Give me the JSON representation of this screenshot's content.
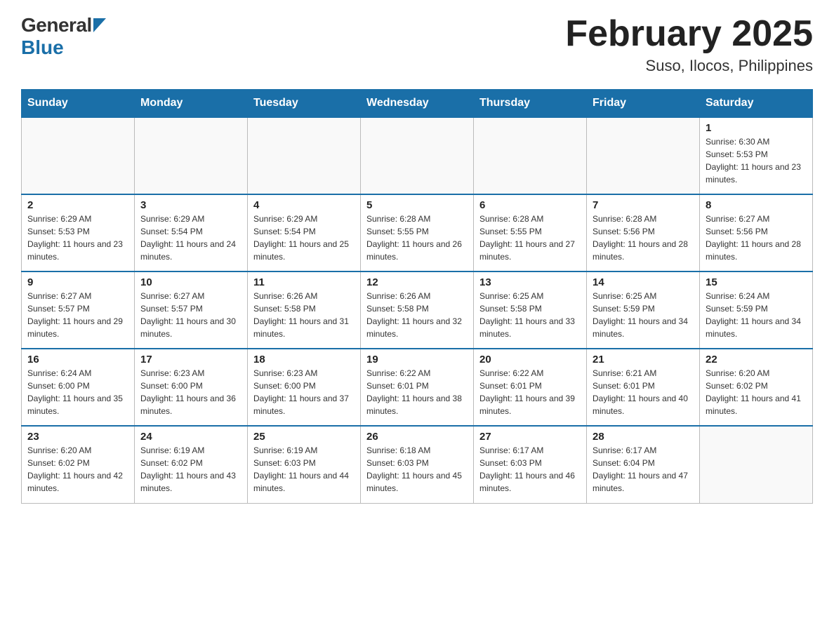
{
  "header": {
    "logo_general": "General",
    "logo_blue": "Blue",
    "month_title": "February 2025",
    "location": "Suso, Ilocos, Philippines"
  },
  "calendar": {
    "days_of_week": [
      "Sunday",
      "Monday",
      "Tuesday",
      "Wednesday",
      "Thursday",
      "Friday",
      "Saturday"
    ],
    "weeks": [
      [
        {
          "day": "",
          "info": ""
        },
        {
          "day": "",
          "info": ""
        },
        {
          "day": "",
          "info": ""
        },
        {
          "day": "",
          "info": ""
        },
        {
          "day": "",
          "info": ""
        },
        {
          "day": "",
          "info": ""
        },
        {
          "day": "1",
          "info": "Sunrise: 6:30 AM\nSunset: 5:53 PM\nDaylight: 11 hours and 23 minutes."
        }
      ],
      [
        {
          "day": "2",
          "info": "Sunrise: 6:29 AM\nSunset: 5:53 PM\nDaylight: 11 hours and 23 minutes."
        },
        {
          "day": "3",
          "info": "Sunrise: 6:29 AM\nSunset: 5:54 PM\nDaylight: 11 hours and 24 minutes."
        },
        {
          "day": "4",
          "info": "Sunrise: 6:29 AM\nSunset: 5:54 PM\nDaylight: 11 hours and 25 minutes."
        },
        {
          "day": "5",
          "info": "Sunrise: 6:28 AM\nSunset: 5:55 PM\nDaylight: 11 hours and 26 minutes."
        },
        {
          "day": "6",
          "info": "Sunrise: 6:28 AM\nSunset: 5:55 PM\nDaylight: 11 hours and 27 minutes."
        },
        {
          "day": "7",
          "info": "Sunrise: 6:28 AM\nSunset: 5:56 PM\nDaylight: 11 hours and 28 minutes."
        },
        {
          "day": "8",
          "info": "Sunrise: 6:27 AM\nSunset: 5:56 PM\nDaylight: 11 hours and 28 minutes."
        }
      ],
      [
        {
          "day": "9",
          "info": "Sunrise: 6:27 AM\nSunset: 5:57 PM\nDaylight: 11 hours and 29 minutes."
        },
        {
          "day": "10",
          "info": "Sunrise: 6:27 AM\nSunset: 5:57 PM\nDaylight: 11 hours and 30 minutes."
        },
        {
          "day": "11",
          "info": "Sunrise: 6:26 AM\nSunset: 5:58 PM\nDaylight: 11 hours and 31 minutes."
        },
        {
          "day": "12",
          "info": "Sunrise: 6:26 AM\nSunset: 5:58 PM\nDaylight: 11 hours and 32 minutes."
        },
        {
          "day": "13",
          "info": "Sunrise: 6:25 AM\nSunset: 5:58 PM\nDaylight: 11 hours and 33 minutes."
        },
        {
          "day": "14",
          "info": "Sunrise: 6:25 AM\nSunset: 5:59 PM\nDaylight: 11 hours and 34 minutes."
        },
        {
          "day": "15",
          "info": "Sunrise: 6:24 AM\nSunset: 5:59 PM\nDaylight: 11 hours and 34 minutes."
        }
      ],
      [
        {
          "day": "16",
          "info": "Sunrise: 6:24 AM\nSunset: 6:00 PM\nDaylight: 11 hours and 35 minutes."
        },
        {
          "day": "17",
          "info": "Sunrise: 6:23 AM\nSunset: 6:00 PM\nDaylight: 11 hours and 36 minutes."
        },
        {
          "day": "18",
          "info": "Sunrise: 6:23 AM\nSunset: 6:00 PM\nDaylight: 11 hours and 37 minutes."
        },
        {
          "day": "19",
          "info": "Sunrise: 6:22 AM\nSunset: 6:01 PM\nDaylight: 11 hours and 38 minutes."
        },
        {
          "day": "20",
          "info": "Sunrise: 6:22 AM\nSunset: 6:01 PM\nDaylight: 11 hours and 39 minutes."
        },
        {
          "day": "21",
          "info": "Sunrise: 6:21 AM\nSunset: 6:01 PM\nDaylight: 11 hours and 40 minutes."
        },
        {
          "day": "22",
          "info": "Sunrise: 6:20 AM\nSunset: 6:02 PM\nDaylight: 11 hours and 41 minutes."
        }
      ],
      [
        {
          "day": "23",
          "info": "Sunrise: 6:20 AM\nSunset: 6:02 PM\nDaylight: 11 hours and 42 minutes."
        },
        {
          "day": "24",
          "info": "Sunrise: 6:19 AM\nSunset: 6:02 PM\nDaylight: 11 hours and 43 minutes."
        },
        {
          "day": "25",
          "info": "Sunrise: 6:19 AM\nSunset: 6:03 PM\nDaylight: 11 hours and 44 minutes."
        },
        {
          "day": "26",
          "info": "Sunrise: 6:18 AM\nSunset: 6:03 PM\nDaylight: 11 hours and 45 minutes."
        },
        {
          "day": "27",
          "info": "Sunrise: 6:17 AM\nSunset: 6:03 PM\nDaylight: 11 hours and 46 minutes."
        },
        {
          "day": "28",
          "info": "Sunrise: 6:17 AM\nSunset: 6:04 PM\nDaylight: 11 hours and 47 minutes."
        },
        {
          "day": "",
          "info": ""
        }
      ]
    ]
  }
}
